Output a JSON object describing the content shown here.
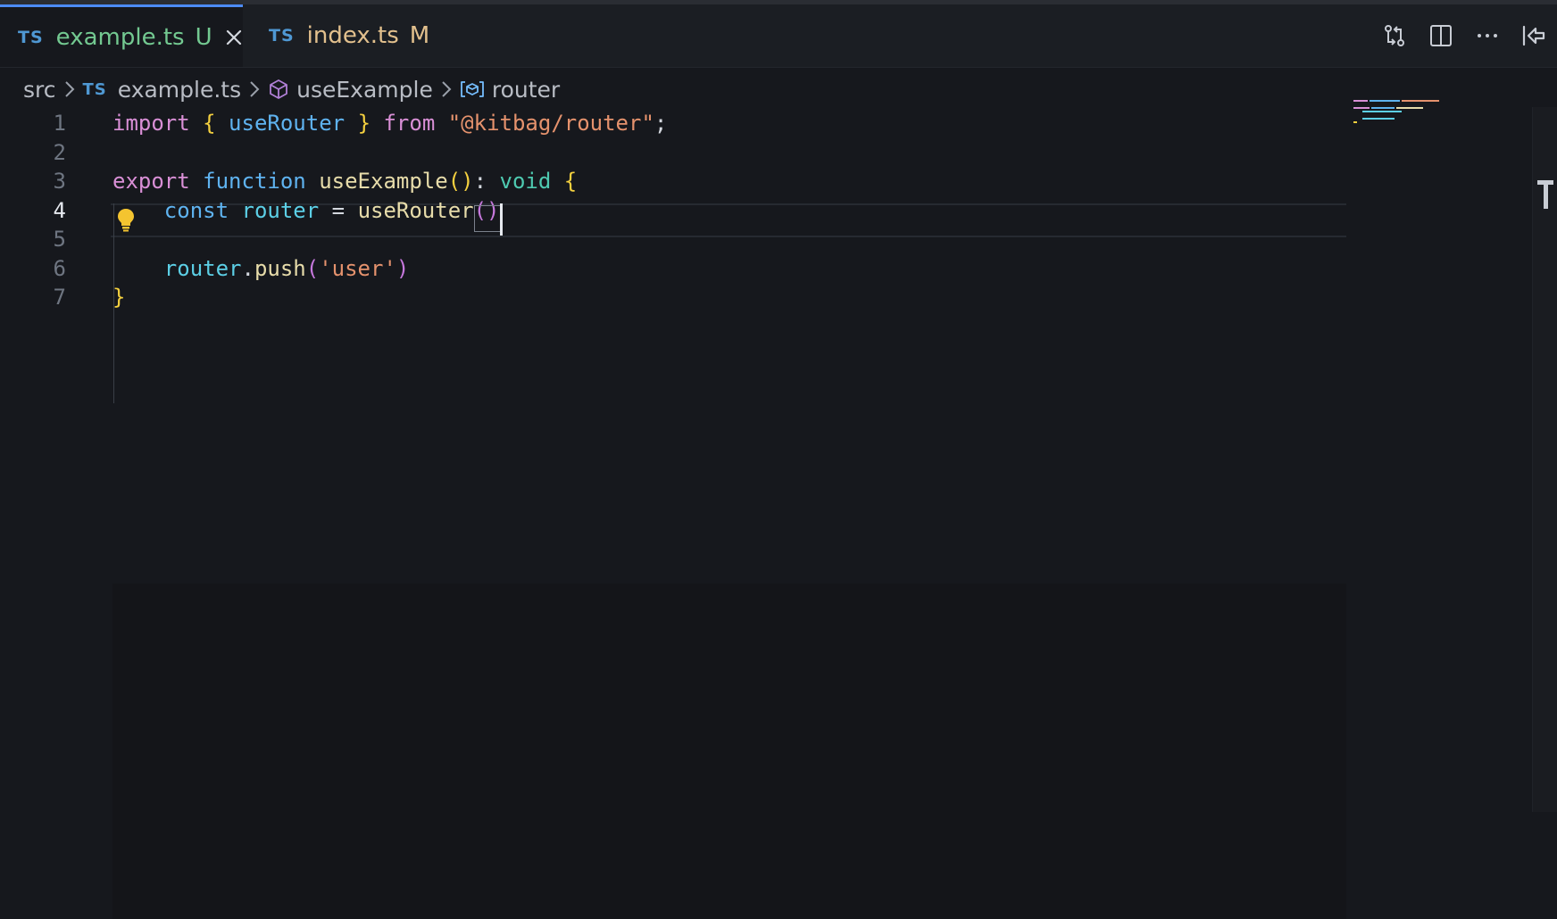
{
  "tabs": [
    {
      "badge": "TS",
      "name": "example.ts",
      "status": "U",
      "active": true
    },
    {
      "badge": "TS",
      "name": "index.ts",
      "status": "M",
      "active": false
    }
  ],
  "toolbar_icons": [
    "git-compare-icon",
    "split-editor-icon",
    "more-actions-icon",
    "go-back-icon"
  ],
  "breadcrumb": {
    "folder": "src",
    "file_badge": "TS",
    "file": "example.ts",
    "function": "useExample",
    "variable": "router"
  },
  "editor": {
    "current_line": 4,
    "line_numbers": [
      "1",
      "2",
      "3",
      "4",
      "5",
      "6",
      "7"
    ],
    "lines": [
      [
        [
          "import",
          "k-pink"
        ],
        [
          " ",
          "k-plain"
        ],
        [
          "{",
          "k-yellow"
        ],
        [
          " useRouter ",
          "k-blue"
        ],
        [
          "}",
          "k-yellow"
        ],
        [
          " from ",
          "k-pink"
        ],
        [
          "\"@kitbag/router\"",
          "k-str"
        ],
        [
          ";",
          "k-plain"
        ]
      ],
      [],
      [
        [
          "export",
          "k-pink"
        ],
        [
          " ",
          "k-plain"
        ],
        [
          "function",
          "k-blue"
        ],
        [
          " ",
          "k-plain"
        ],
        [
          "useExample",
          "k-fn"
        ],
        [
          "()",
          "k-yellow"
        ],
        [
          ":",
          "k-plain"
        ],
        [
          " void",
          "k-cyan"
        ],
        [
          " ",
          "k-plain"
        ],
        [
          "{",
          "k-yellow"
        ]
      ],
      [
        [
          "    ",
          "k-plain"
        ],
        [
          "const",
          "k-blue"
        ],
        [
          " router",
          "k-teal"
        ],
        [
          " = ",
          "k-plain"
        ],
        [
          "useRouter",
          "k-fn"
        ],
        [
          "()",
          "k-purple"
        ]
      ],
      [],
      [
        [
          "    ",
          "k-plain"
        ],
        [
          "router",
          "k-teal"
        ],
        [
          ".",
          "k-plain"
        ],
        [
          "push",
          "k-fn"
        ],
        [
          "(",
          "k-purple"
        ],
        [
          "'user'",
          "k-str"
        ],
        [
          ")",
          "k-purple"
        ]
      ],
      [
        [
          "}",
          "k-yellow"
        ]
      ]
    ]
  },
  "colors": {
    "accent": "#4c8bf5",
    "untracked": "#73c991",
    "modified": "#e2c08d",
    "lightbulb": "#f4c430"
  }
}
